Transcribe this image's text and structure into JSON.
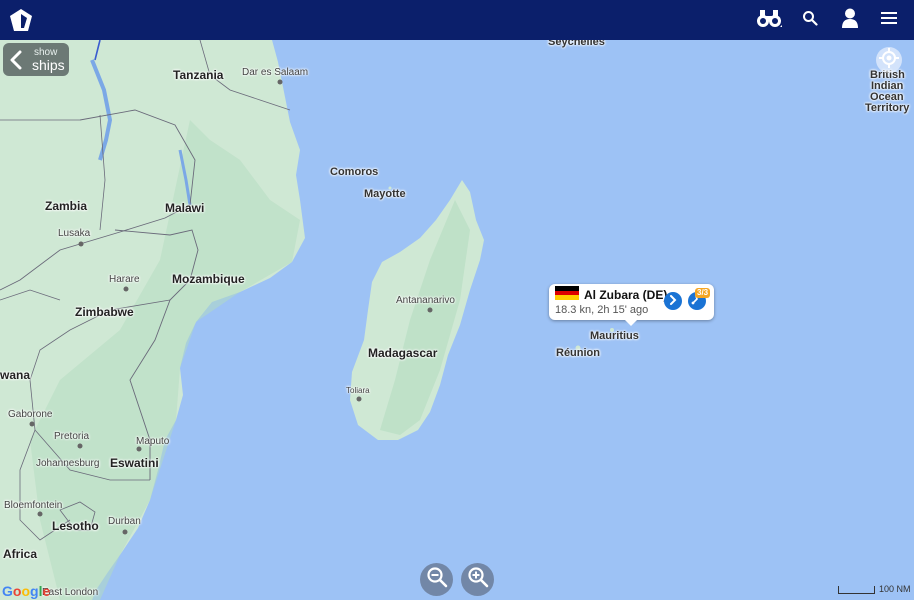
{
  "toolbar": {
    "logo_icon": "house-shield-icon",
    "binoculars_icon": "binoculars-icon",
    "search_icon": "search-icon",
    "account_icon": "user-icon",
    "menu_icon": "hamburger-menu-icon"
  },
  "colors": {
    "topbar": "#0b1f6b",
    "ocean": "#9dc2f5",
    "land": "#cfe8d4",
    "land_dark": "#b4dcc0",
    "popup_button": "#1a73d4",
    "badge": "#f5a623"
  },
  "show_ships": {
    "line1": "show",
    "line2": "ships",
    "icon": "chevron-left-icon"
  },
  "map": {
    "labels": [
      {
        "text": "Seychelles",
        "size": "med"
      },
      {
        "text": "Tanzania",
        "size": "big"
      },
      {
        "text": "Dar es Salaam",
        "size": "sm"
      },
      {
        "text": "British",
        "size": "med"
      },
      {
        "text": "Indian",
        "size": "med"
      },
      {
        "text": "Ocean",
        "size": "med"
      },
      {
        "text": "Territory",
        "size": "med"
      },
      {
        "text": "Comoros",
        "size": "med"
      },
      {
        "text": "Mayotte",
        "size": "med"
      },
      {
        "text": "Zambia",
        "size": "big"
      },
      {
        "text": "Malawi",
        "size": "big"
      },
      {
        "text": "Lusaka",
        "size": "sm"
      },
      {
        "text": "Harare",
        "size": "sm"
      },
      {
        "text": "Mozambique",
        "size": "big"
      },
      {
        "text": "Zimbabwe",
        "size": "big"
      },
      {
        "text": "Antananarivo",
        "size": "sm"
      },
      {
        "text": "Madagascar",
        "size": "big"
      },
      {
        "text": "Mauritius",
        "size": "med"
      },
      {
        "text": "Réunion",
        "size": "med"
      },
      {
        "text": "wana",
        "size": "big"
      },
      {
        "text": "Toliara",
        "size": "xs"
      },
      {
        "text": "Gaborone",
        "size": "sm"
      },
      {
        "text": "Pretoria",
        "size": "sm"
      },
      {
        "text": "Maputo",
        "size": "sm"
      },
      {
        "text": "Johannesburg",
        "size": "sm"
      },
      {
        "text": "Eswatini",
        "size": "big"
      },
      {
        "text": "Bloemfontein",
        "size": "sm"
      },
      {
        "text": "Lesotho",
        "size": "big"
      },
      {
        "text": "Durban",
        "size": "sm"
      },
      {
        "text": "Africa",
        "size": "big"
      },
      {
        "text": "East London",
        "size": "sm"
      }
    ]
  },
  "ship_popup": {
    "name": "Al Zubara (DE)",
    "status": "18.3 kn, 2h 15' ago",
    "flag_country": "Germany",
    "badge": "3/3",
    "details_icon": "chevron-right-icon",
    "track_icon": "route-icon"
  },
  "zoom": {
    "out_icon": "zoom-out-icon",
    "in_icon": "zoom-in-icon"
  },
  "attribution": {
    "google": "Google"
  },
  "scale": {
    "label": "100 NM"
  },
  "locate_icon": "locate-icon"
}
